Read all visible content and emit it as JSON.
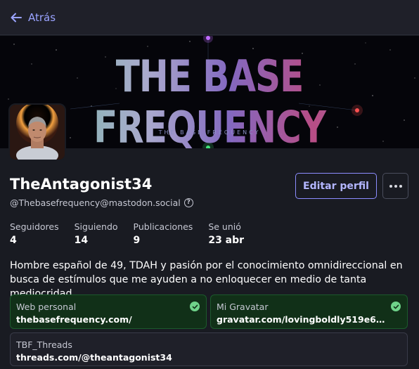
{
  "topbar": {
    "back_label": "Atrás"
  },
  "banner": {
    "title": "THE BASE FREQUENCY",
    "subtitle": "THE BASE FREQUENCY"
  },
  "profile": {
    "display_name": "TheAntagonist34",
    "handle": "@Thebasefrequency@mastodon.social",
    "edit_label": "Editar perfil"
  },
  "stats": [
    {
      "label": "Seguidores",
      "value": "4"
    },
    {
      "label": "Siguiendo",
      "value": "14"
    },
    {
      "label": "Publicaciones",
      "value": "9"
    },
    {
      "label": "Se unió",
      "value": "23 abr"
    }
  ],
  "bio": "Hombre español de 49, TDAH y pasión por el conocimiento omnidireccional en busca de estímulos que me ayuden a no enloquecer en medio de tanta mediocridad.",
  "fields": [
    {
      "label": "Web personal",
      "value": "thebasefrequency.com/",
      "verified": true
    },
    {
      "label": "Mi Gravatar",
      "value": "gravatar.com/lovingboldly519e6…",
      "verified": true
    },
    {
      "label": "TBF_Threads",
      "value": "threads.com/@theantagonist34",
      "verified": false
    }
  ],
  "colors": {
    "accent": "#8c8dff",
    "verified_bg": "#113018",
    "verified_check": "#6fd38a",
    "background": "#191b22"
  }
}
